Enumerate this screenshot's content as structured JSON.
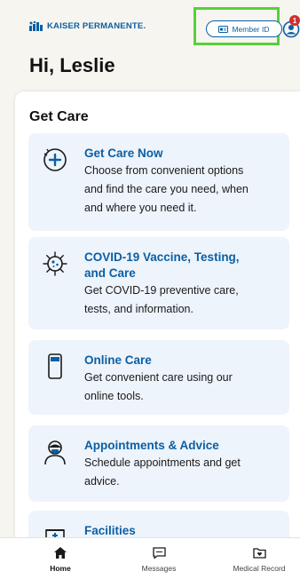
{
  "header": {
    "logo_text": "KAISER PERMANENTE.",
    "member_id_label": "Member ID",
    "notification_count": "1",
    "greeting": "Hi, Leslie"
  },
  "get_care": {
    "title": "Get Care",
    "items": [
      {
        "title": "Get Care Now",
        "desc_lines": [
          "Choose from convenient options",
          "and find the care you need, when",
          "and where you need it."
        ],
        "icon": "stethoscope-plus-icon"
      },
      {
        "title_lines": [
          "COVID-19 Vaccine, Testing,",
          "and Care"
        ],
        "desc_lines": [
          "Get COVID-19 preventive care,",
          "tests, and information."
        ],
        "icon": "virus-icon"
      },
      {
        "title": "Online Care",
        "desc_lines": [
          "Get convenient care using our",
          "online tools."
        ],
        "icon": "phone-icon"
      },
      {
        "title": "Appointments & Advice",
        "desc_lines": [
          "Schedule appointments and get",
          "advice."
        ],
        "icon": "doctor-icon"
      },
      {
        "title": "Facilities",
        "icon": "building-icon"
      }
    ]
  },
  "bottom_nav": {
    "home": "Home",
    "messages": "Messages",
    "medical_record": "Medical Record"
  },
  "colors": {
    "brand_blue": "#0b5fa5",
    "highlight_green": "#56d13a",
    "badge_red": "#d12e2e",
    "card_bg": "#eef4fb"
  }
}
